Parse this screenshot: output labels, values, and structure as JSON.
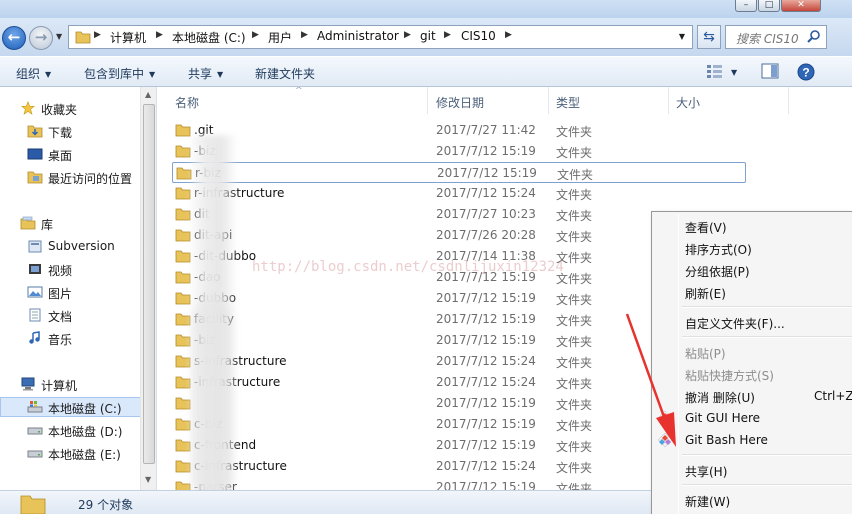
{
  "window": {
    "minimize_glyph": "–",
    "maximize_glyph": "□",
    "close_glyph": "✕"
  },
  "address": {
    "crumbs": [
      "计算机",
      "本地磁盘 (C:)",
      "用户",
      "Administrator",
      "git",
      "CIS10"
    ],
    "search_placeholder": "搜索 CIS10"
  },
  "toolbar": {
    "organize": "组织",
    "include_in_library": "包含到库中",
    "share": "共享",
    "new_folder": "新建文件夹"
  },
  "nav": {
    "favorites": "收藏夹",
    "downloads": "下载",
    "desktop": "桌面",
    "recent": "最近访问的位置",
    "libraries": "库",
    "subversion": "Subversion",
    "videos": "视频",
    "pictures": "图片",
    "documents": "文档",
    "music": "音乐",
    "computer": "计算机",
    "drive_c": "本地磁盘 (C:)",
    "drive_d": "本地磁盘 (D:)",
    "drive_e": "本地磁盘 (E:)"
  },
  "columns": {
    "name": "名称",
    "modified": "修改日期",
    "type": "类型",
    "size": "大小"
  },
  "files": [
    {
      "name": ".git",
      "date": "2017/7/27 11:42",
      "type": "文件夹"
    },
    {
      "name": "-biz",
      "date": "2017/7/12 15:19",
      "type": "文件夹"
    },
    {
      "name": "r-biz",
      "date": "2017/7/12 15:19",
      "type": "文件夹"
    },
    {
      "name": "r-infrastructure",
      "date": "2017/7/12 15:24",
      "type": "文件夹"
    },
    {
      "name": "dit",
      "date": "2017/7/27 10:23",
      "type": "文件夹"
    },
    {
      "name": "dit-api",
      "date": "2017/7/26 20:28",
      "type": "文件夹"
    },
    {
      "name": "-dit-dubbo",
      "date": "2017/7/14 11:38",
      "type": "文件夹"
    },
    {
      "name": "-dao",
      "date": "2017/7/12 15:19",
      "type": "文件夹"
    },
    {
      "name": "-dubbo",
      "date": "2017/7/12 15:19",
      "type": "文件夹"
    },
    {
      "name": "facility",
      "date": "2017/7/12 15:19",
      "type": "文件夹"
    },
    {
      "name": "-biz",
      "date": "2017/7/12 15:19",
      "type": "文件夹"
    },
    {
      "name": "s-infrastructure",
      "date": "2017/7/12 15:24",
      "type": "文件夹"
    },
    {
      "name": "-infrastructure",
      "date": "2017/7/12 15:24",
      "type": "文件夹"
    },
    {
      "name": "",
      "date": "2017/7/12 15:19",
      "type": "文件夹"
    },
    {
      "name": "c-biz",
      "date": "2017/7/12 15:19",
      "type": "文件夹"
    },
    {
      "name": "c-frontend",
      "date": "2017/7/12 15:19",
      "type": "文件夹"
    },
    {
      "name": "c-infrastructure",
      "date": "2017/7/12 15:24",
      "type": "文件夹"
    },
    {
      "name": "-parser",
      "date": "2017/7/12 15:19",
      "type": "文件夹"
    }
  ],
  "watermark": "http://blog.csdn.net/csdnlijuxin12324",
  "status": {
    "count": "29 个对象"
  },
  "context_menu": {
    "view": "查看(V)",
    "sort_by": "排序方式(O)",
    "group_by": "分组依据(P)",
    "refresh": "刷新(E)",
    "customize": "自定义文件夹(F)...",
    "paste": "粘贴(P)",
    "paste_shortcut": "粘贴快捷方式(S)",
    "undo_delete": "撤消 删除(U)",
    "undo_shortcut": "Ctrl+Z",
    "git_gui": "Git GUI Here",
    "git_bash": "Git Bash Here",
    "share": "共享(H)",
    "new": "新建(W)"
  },
  "colors": {
    "arrow": "#e8322e",
    "selection": "#d9e8fb",
    "folder": "#e8c35a"
  }
}
